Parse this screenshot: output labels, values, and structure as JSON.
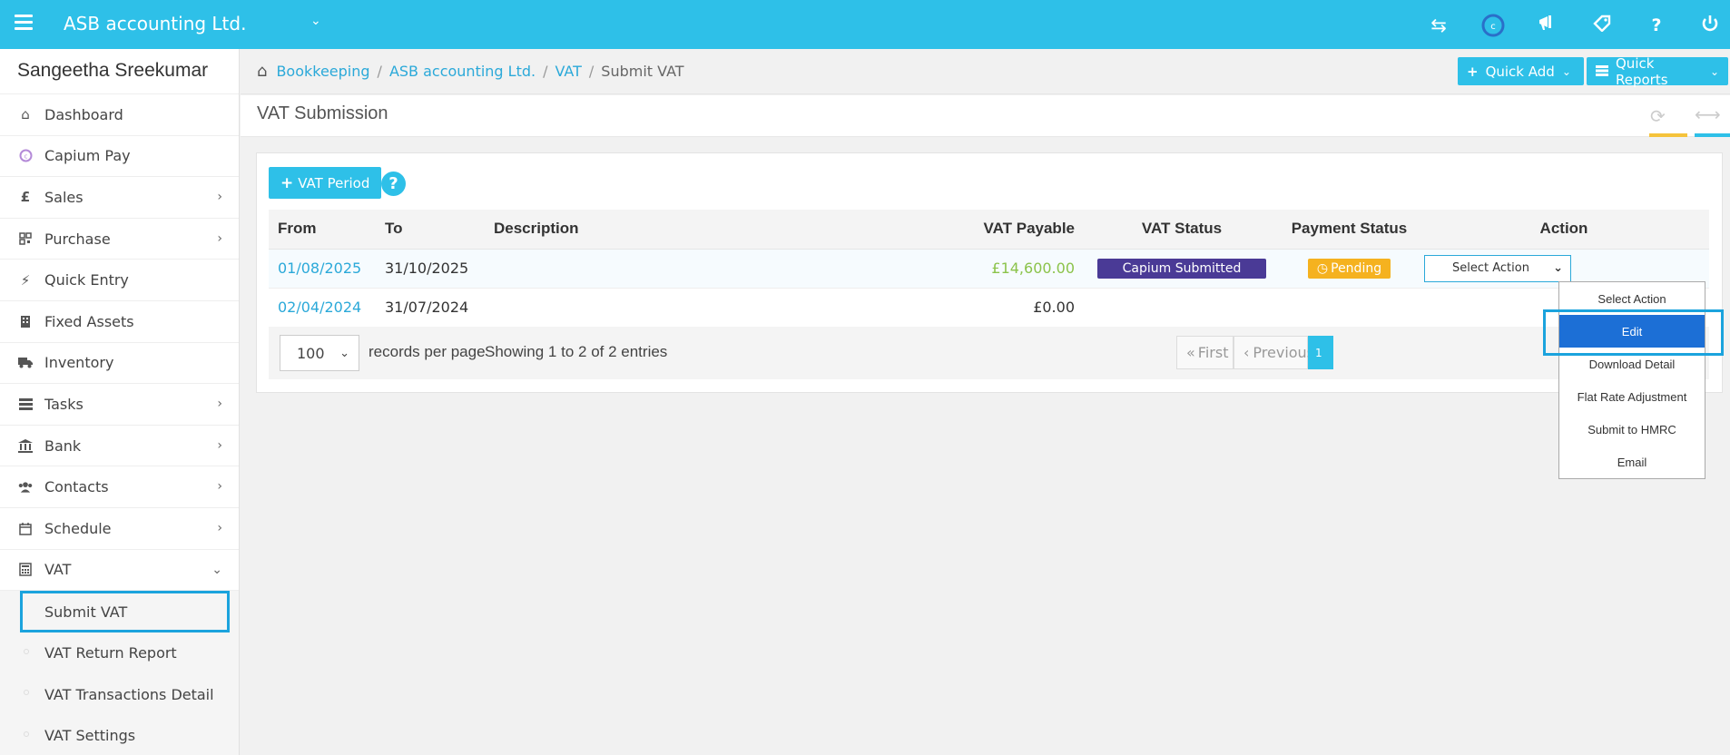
{
  "topbar": {
    "company": "ASB accounting Ltd.",
    "icons": [
      "transfer-icon",
      "capium-logo-icon",
      "megaphone-icon",
      "tag-icon",
      "help-icon",
      "power-icon"
    ]
  },
  "sidebar": {
    "user": "Sangeetha Sreekumar",
    "items": [
      {
        "label": "Dashboard",
        "icon": "home-icon"
      },
      {
        "label": "Capium Pay",
        "icon": "capium-pay-icon"
      },
      {
        "label": "Sales",
        "icon": "pound-icon"
      },
      {
        "label": "Purchase",
        "icon": "qr-icon"
      },
      {
        "label": "Quick Entry",
        "icon": "bolt-icon"
      },
      {
        "label": "Fixed Assets",
        "icon": "building-icon"
      },
      {
        "label": "Inventory",
        "icon": "truck-icon"
      },
      {
        "label": "Tasks",
        "icon": "tasks-icon"
      },
      {
        "label": "Bank",
        "icon": "bank-icon"
      },
      {
        "label": "Contacts",
        "icon": "users-icon"
      },
      {
        "label": "Schedule",
        "icon": "calendar-icon"
      },
      {
        "label": "VAT",
        "icon": "calculator-icon"
      }
    ],
    "vat_sub": [
      "Submit VAT",
      "VAT Return Report",
      "VAT Transactions Detail",
      "VAT Settings"
    ]
  },
  "breadcrumb": {
    "items": [
      "Bookkeeping",
      "ASB accounting Ltd.",
      "VAT"
    ],
    "current": "Submit VAT"
  },
  "header_buttons": {
    "quick_add": "Quick Add",
    "quick_reports": "Quick Reports"
  },
  "page": {
    "title": "VAT Submission",
    "vat_period_button": "VAT Period"
  },
  "table": {
    "headers": [
      "From",
      "To",
      "Description",
      "VAT Payable",
      "VAT Status",
      "Payment Status",
      "Action"
    ],
    "rows": [
      {
        "from": "01/08/2025",
        "to": "31/10/2025",
        "description": "",
        "vat_payable": "£14,600.00",
        "vat_status": "Capium Submitted",
        "payment_status": "Pending",
        "action": "Select Action"
      },
      {
        "from": "02/04/2024",
        "to": "31/07/2024",
        "description": "",
        "vat_payable": "£0.00",
        "vat_status": "",
        "payment_status": "",
        "action": ""
      }
    ]
  },
  "pagination": {
    "per_page": "100",
    "per_page_label": "records per page",
    "info": "Showing 1 to 2 of 2 entries",
    "first": "First",
    "previous": "Previous",
    "current_page": "1"
  },
  "action_dropdown": {
    "options": [
      "Select Action",
      "Edit",
      "Download Detail",
      "Flat Rate Adjustment",
      "Submit to HMRC",
      "Email"
    ],
    "highlighted": "Edit"
  },
  "colors": {
    "brand": "#2ec0e8",
    "vat_status_badge": "#4a3a96",
    "pending_badge": "#f5b21f",
    "highlight": "#1ba3dd",
    "selected_option": "#1c6fd6"
  }
}
